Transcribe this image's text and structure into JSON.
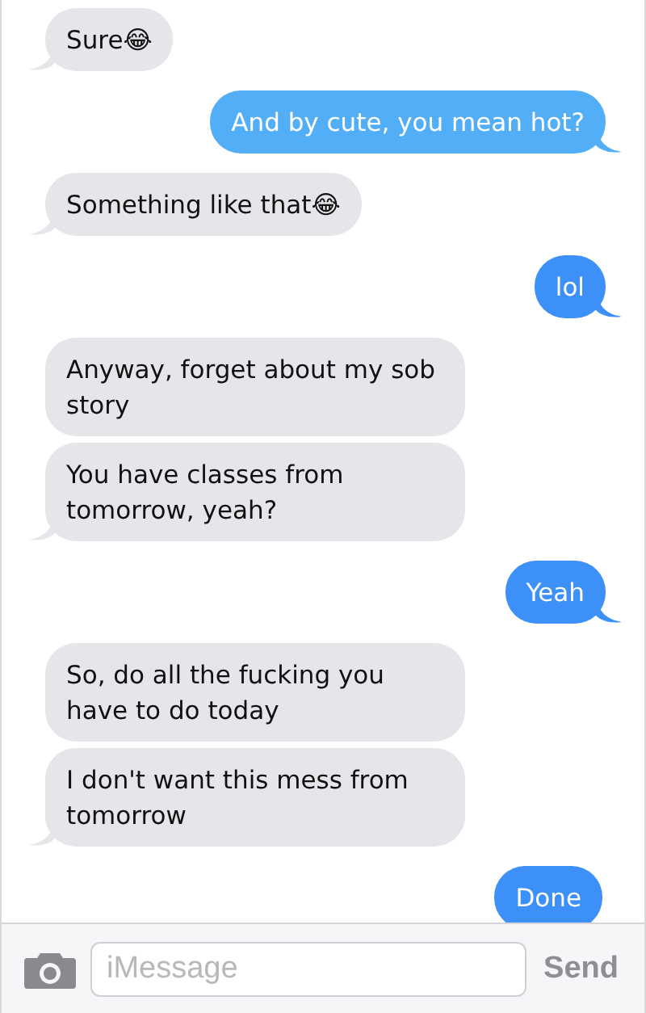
{
  "messages": [
    {
      "kind": "incoming",
      "text": "Sure😂",
      "tail": true,
      "color": "#e5e5ea"
    },
    {
      "kind": "outgoing",
      "text": "And by cute, you mean hot?",
      "tail": true,
      "color": "#53aef8"
    },
    {
      "kind": "incoming",
      "text": "Something like that😂",
      "tail": true,
      "color": "#e5e5ea"
    },
    {
      "kind": "outgoing",
      "text": "lol",
      "tail": true,
      "color": "#3d90f8"
    },
    {
      "kind": "incoming",
      "text": "Anyway, forget about my sob story",
      "tail": false,
      "color": "#e5e5ea"
    },
    {
      "kind": "incoming",
      "text": "You have classes from tomorrow, yeah?",
      "tail": true,
      "color": "#e5e5ea"
    },
    {
      "kind": "outgoing",
      "text": "Yeah",
      "tail": true,
      "color": "#3d90f8"
    },
    {
      "kind": "incoming",
      "text": "So, do all the fucking you have to do today",
      "tail": false,
      "color": "#e5e5ea"
    },
    {
      "kind": "incoming",
      "text": "I don't want this mess from tomorrow",
      "tail": true,
      "color": "#e5e5ea"
    },
    {
      "kind": "outgoing",
      "text": "Done",
      "tail": false,
      "color": "#3d90f8"
    }
  ],
  "composer": {
    "placeholder": "iMessage",
    "send": "Send"
  }
}
